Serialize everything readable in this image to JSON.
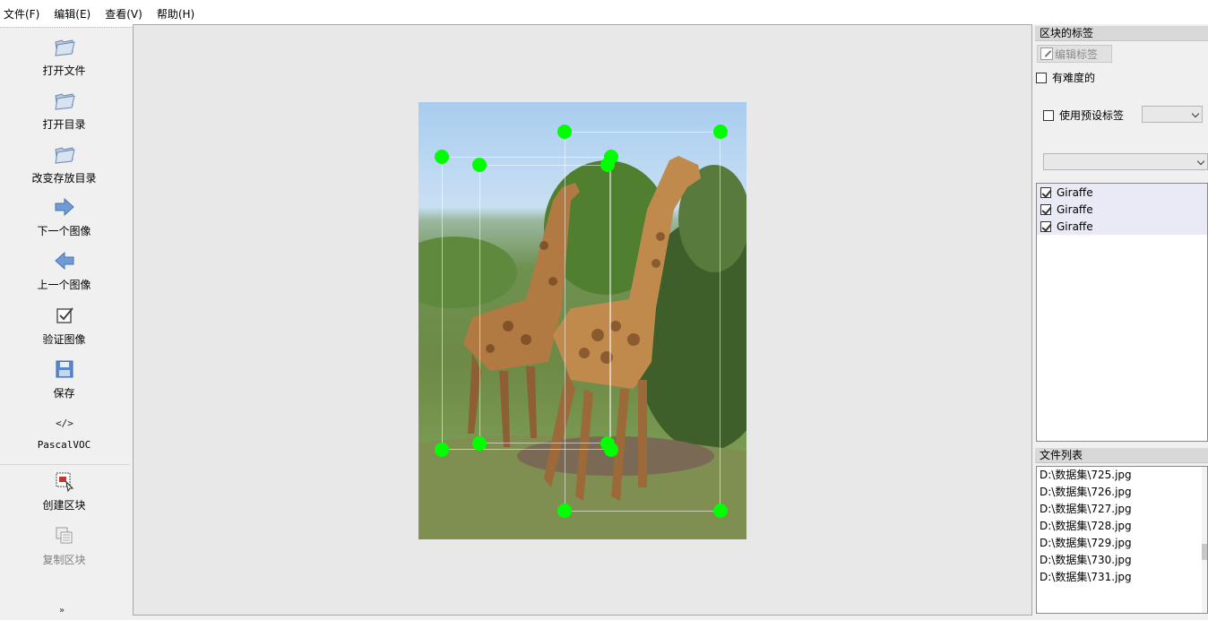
{
  "menu": {
    "file": "文件(F)",
    "edit": "编辑(E)",
    "view": "查看(V)",
    "help": "帮助(H)"
  },
  "toolbar": {
    "open_file": "打开文件",
    "open_dir": "打开目录",
    "change_save_dir": "改变存放目录",
    "next_image": "下一个图像",
    "prev_image": "上一个图像",
    "verify_image": "验证图像",
    "save": "保存",
    "format": "PascalVOC",
    "create_box": "创建区块",
    "copy_box": "复制区块",
    "more": "»"
  },
  "labels_panel": {
    "title": "区块的标签",
    "edit_label": "编辑标签",
    "difficult": "有难度的",
    "difficult_checked": false,
    "use_default": "使用预设标签",
    "use_default_checked": false,
    "default_value": "",
    "filter_value": "",
    "items": [
      {
        "label": "Giraffe",
        "checked": true
      },
      {
        "label": "Giraffe",
        "checked": true
      },
      {
        "label": "Giraffe",
        "checked": true
      }
    ]
  },
  "file_panel": {
    "title": "文件列表",
    "files": [
      "D:\\数据集\\725.jpg",
      "D:\\数据集\\726.jpg",
      "D:\\数据集\\727.jpg",
      "D:\\数据集\\728.jpg",
      "D:\\数据集\\729.jpg",
      "D:\\数据集\\730.jpg",
      "D:\\数据集\\731.jpg"
    ]
  },
  "colors": {
    "handle": "#00ff00",
    "canvas_bg": "#e8e8e8",
    "label_item_bg": "#eaeaf6"
  }
}
